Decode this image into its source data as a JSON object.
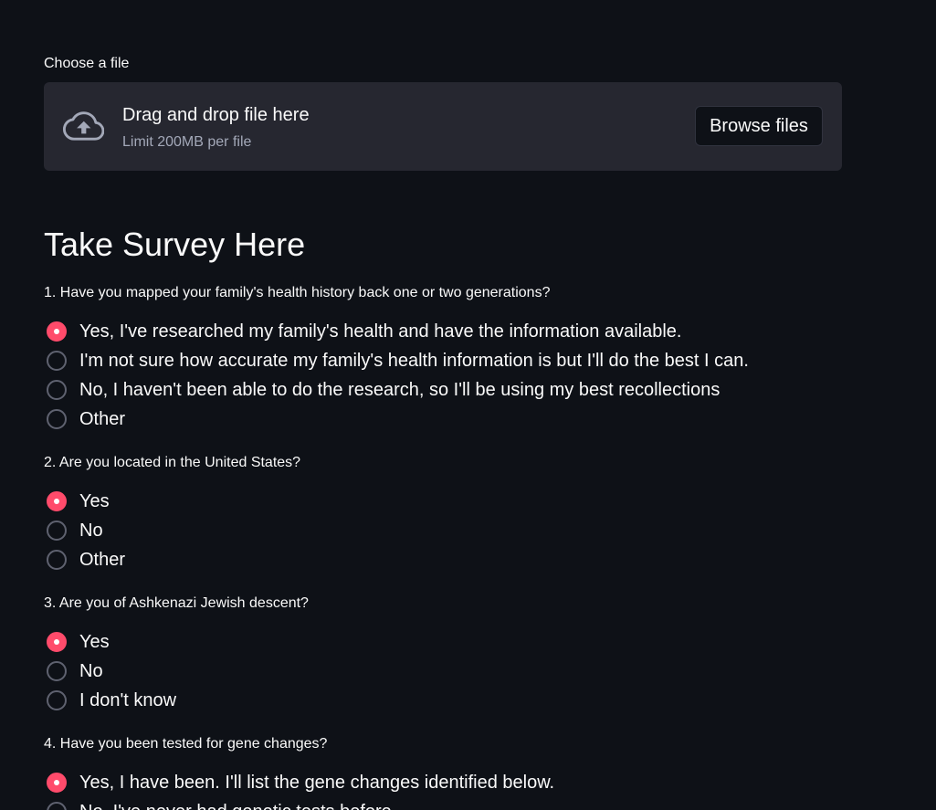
{
  "uploader": {
    "label": "Choose a file",
    "title": "Drag and drop file here",
    "limit": "Limit 200MB per file",
    "browse_label": "Browse files",
    "icon": "cloud-upload-icon"
  },
  "survey": {
    "title": "Take Survey Here",
    "questions": [
      {
        "label": "1. Have you mapped your family's health history back one or two generations?",
        "options": [
          {
            "label": "Yes, I've researched my family's health and have the information available.",
            "selected": true
          },
          {
            "label": "I'm not sure how accurate my family's health information is but I'll do the best I can.",
            "selected": false
          },
          {
            "label": "No, I haven't been able to do the research, so I'll be using my best recollections",
            "selected": false
          },
          {
            "label": "Other",
            "selected": false
          }
        ]
      },
      {
        "label": "2. Are you located in the United States?",
        "options": [
          {
            "label": "Yes",
            "selected": true
          },
          {
            "label": "No",
            "selected": false
          },
          {
            "label": "Other",
            "selected": false
          }
        ]
      },
      {
        "label": "3. Are you of Ashkenazi Jewish descent?",
        "options": [
          {
            "label": "Yes",
            "selected": true
          },
          {
            "label": "No",
            "selected": false
          },
          {
            "label": "I don't know",
            "selected": false
          }
        ]
      },
      {
        "label": "4. Have you been tested for gene changes?",
        "options": [
          {
            "label": "Yes, I have been. I'll list the gene changes identified below.",
            "selected": true
          },
          {
            "label": "No, I've never had genetic tests before",
            "selected": false
          }
        ]
      }
    ]
  },
  "colors": {
    "background": "#0e1117",
    "accent": "#ff4b6b",
    "dropzone": "#262730"
  }
}
